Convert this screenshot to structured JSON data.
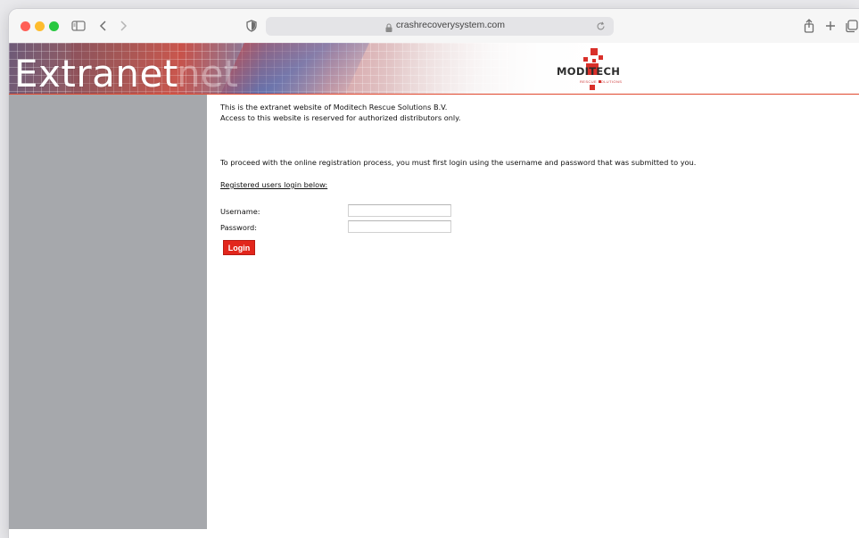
{
  "browser": {
    "url": "crashrecoverysystem.com"
  },
  "banner": {
    "title": "Extranet",
    "ghost_text": "net",
    "logo_text": "MODITECH",
    "logo_tagline": "RESCUE SOLUTIONS"
  },
  "content": {
    "intro_line1": "This is the extranet website of Moditech Rescue Solutions B.V.",
    "intro_line2": "Access to this website is reserved for authorized distributors only.",
    "proceed_text": "To proceed with the online registration process, you must first login using the username and password that was submitted to you.",
    "registered_link": "Registered users login below:"
  },
  "form": {
    "username_label": "Username:",
    "username_value": "",
    "password_label": "Password:",
    "password_value": "",
    "login_button": "Login"
  },
  "colors": {
    "accent_red": "#e2261c",
    "sidebar_gray": "#a6a8ac"
  }
}
